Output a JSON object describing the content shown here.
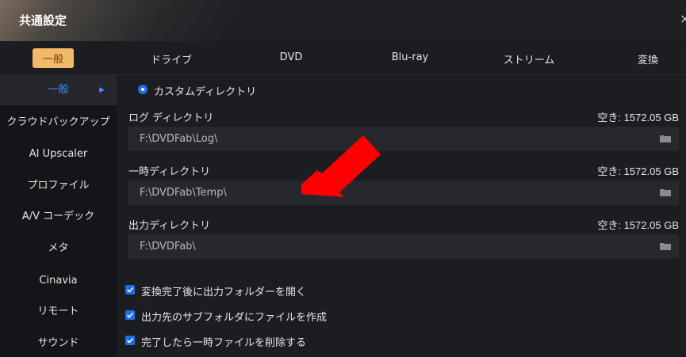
{
  "window": {
    "title": "共通設定",
    "close_glyph": "×"
  },
  "tabs": [
    {
      "label": "一般",
      "active": true
    },
    {
      "label": "ドライブ",
      "active": false
    },
    {
      "label": "DVD",
      "active": false
    },
    {
      "label": "Blu-ray",
      "active": false
    },
    {
      "label": "ストリーム",
      "active": false
    },
    {
      "label": "変換",
      "active": false
    }
  ],
  "sidebar": {
    "items": [
      {
        "label": "一般",
        "active": true
      },
      {
        "label": "クラウドバックアップ"
      },
      {
        "label": "AI Upscaler"
      },
      {
        "label": "プロファイル"
      },
      {
        "label": "A/V コーデック"
      },
      {
        "label": "メタ"
      },
      {
        "label": "Cinavia"
      },
      {
        "label": "リモート"
      },
      {
        "label": "サウンド"
      }
    ]
  },
  "custom_dir": {
    "label": "カスタムディレクトリ",
    "selected": true
  },
  "directories": [
    {
      "label": "ログ ディレクトリ",
      "free_space": "空き: 1572.05 GB",
      "path": "F:\\DVDFab\\Log\\"
    },
    {
      "label": "一時ディレクトリ",
      "free_space": "空き: 1572.05 GB",
      "path": "F:\\DVDFab\\Temp\\"
    },
    {
      "label": "出力ディレクトリ",
      "free_space": "空き: 1572.05 GB",
      "path": "F:\\DVDFab\\"
    }
  ],
  "options": [
    {
      "label": "変換完了後に出力フォルダーを開く",
      "checked": true
    },
    {
      "label": "出力先のサブフォルダにファイルを作成",
      "checked": true
    },
    {
      "label": "完了したら一時ファイルを削除する",
      "checked": true
    }
  ],
  "colors": {
    "accent_blue": "#1e6fe8",
    "active_tab_bg": "#f2b96b",
    "annotation_arrow": "#ff0000"
  },
  "icons": {
    "folder": "folder-icon",
    "active_item_arrow": "chevron-right-icon",
    "annotation": "red-arrow-annotation"
  }
}
